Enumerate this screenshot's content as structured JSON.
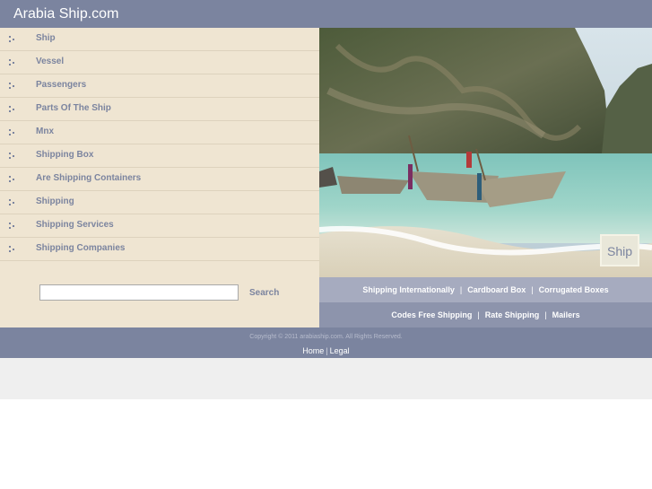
{
  "header": {
    "logo": "Arabia Ship.com"
  },
  "sidebar": {
    "items": [
      {
        "label": "Ship"
      },
      {
        "label": "Vessel"
      },
      {
        "label": "Passengers"
      },
      {
        "label": "Parts Of The Ship"
      },
      {
        "label": "Mnx"
      },
      {
        "label": "Shipping Box"
      },
      {
        "label": "Are Shipping Containers"
      },
      {
        "label": "Shipping"
      },
      {
        "label": "Shipping Services"
      },
      {
        "label": "Shipping Companies"
      }
    ],
    "search": {
      "value": "",
      "button_label": "Search"
    }
  },
  "hero": {
    "badge": "Ship"
  },
  "links": {
    "row1": [
      "Shipping Internationally",
      "Cardboard Box",
      "Corrugated Boxes"
    ],
    "row2": [
      "Codes Free Shipping",
      "Rate Shipping",
      "Mailers"
    ],
    "separator": "|"
  },
  "footer": {
    "copyright": "Copyright © 2011 arabiaship.com. All Rights Reserved.",
    "home": "Home",
    "separator": "|",
    "legal": "Legal"
  },
  "colors": {
    "header": "#7b849f",
    "sidebar": "#efe5d2",
    "link_text": "#7b849f",
    "links_row1": "#a6abbf",
    "links_row2": "#8d94ac",
    "bottom_band": "#efefef"
  }
}
